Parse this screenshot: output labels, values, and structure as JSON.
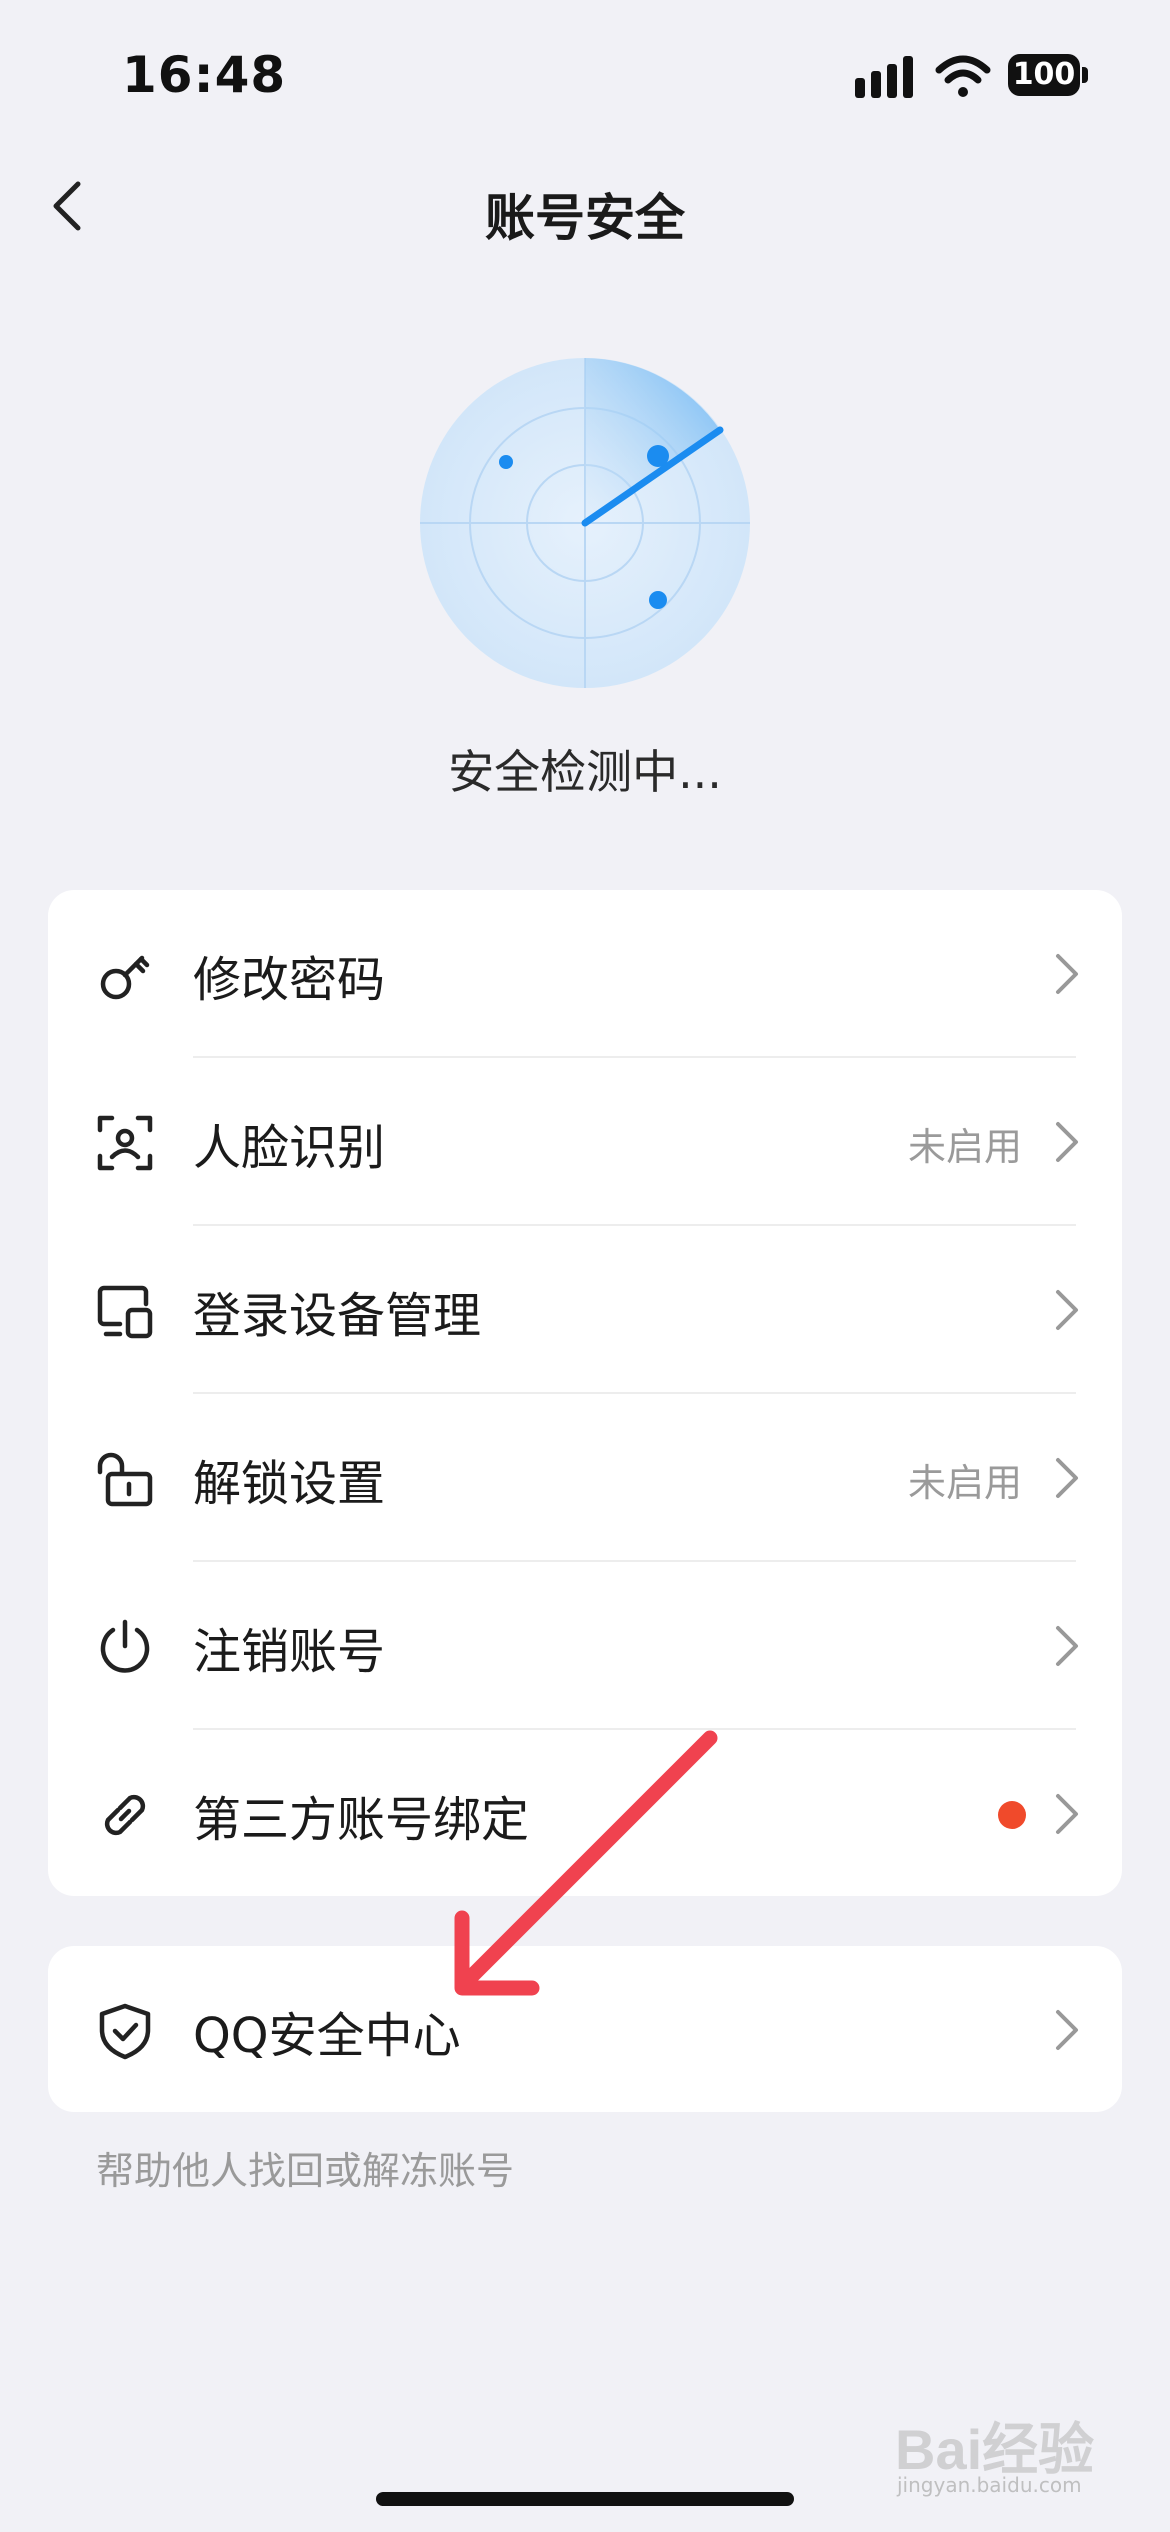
{
  "status_bar": {
    "time": "16:48",
    "battery": "100"
  },
  "header": {
    "title": "账号安全"
  },
  "scan": {
    "text": "安全检测中..."
  },
  "menu": {
    "items": [
      {
        "label": "修改密码",
        "status": "",
        "icon": "key-icon"
      },
      {
        "label": "人脸识别",
        "status": "未启用",
        "icon": "face-scan-icon"
      },
      {
        "label": "登录设备管理",
        "status": "",
        "icon": "devices-icon"
      },
      {
        "label": "解锁设置",
        "status": "未启用",
        "icon": "unlock-icon"
      },
      {
        "label": "注销账号",
        "status": "",
        "icon": "power-icon"
      },
      {
        "label": "第三方账号绑定",
        "status": "",
        "icon": "link-icon",
        "badge_color": "#F04A2B"
      }
    ]
  },
  "qq_center": {
    "label": "QQ安全中心",
    "icon": "shield-check-icon"
  },
  "helper_text": "帮助他人找回或解冻账号",
  "watermark": {
    "brand": "Bai经验",
    "url": "jingyan.baidu.com"
  },
  "colors": {
    "background": "#F1F1F6",
    "accent": "#1B8CF0",
    "annotation": "#F0424F",
    "badge": "#F04A2B"
  }
}
